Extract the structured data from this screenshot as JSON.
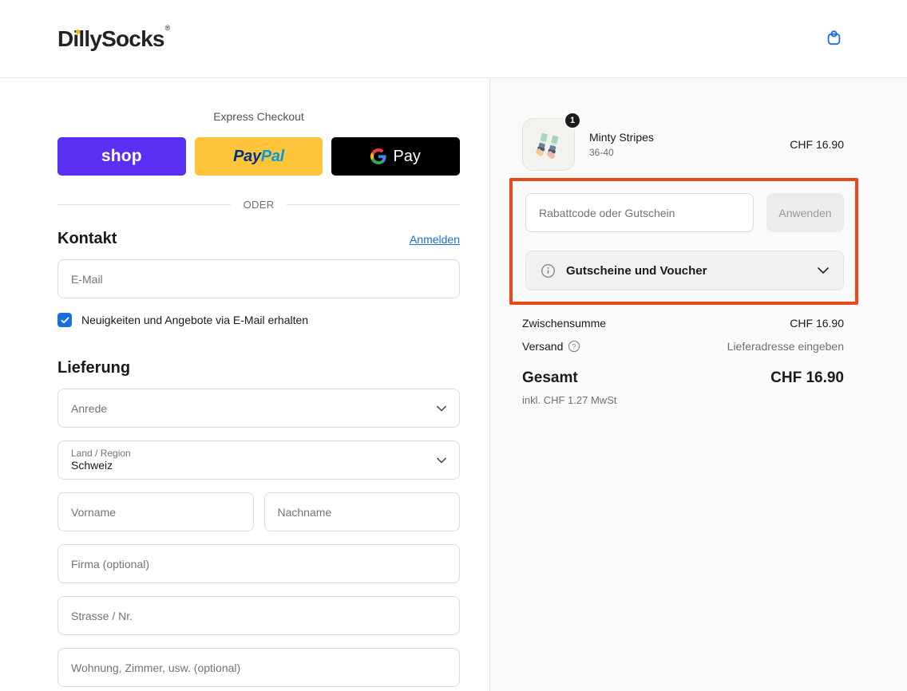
{
  "header": {
    "logo_text": "DillySocks",
    "logo_reg": "®"
  },
  "express": {
    "title": "Express Checkout",
    "divider": "ODER",
    "shop_label": "shop",
    "paypal_pay": "Pay",
    "paypal_pal": "Pal",
    "gpay_label": "Pay"
  },
  "contact": {
    "title": "Kontakt",
    "login_link": "Anmelden",
    "email_placeholder": "E-Mail",
    "newsletter_label": "Neuigkeiten und Angebote via E-Mail erhalten"
  },
  "shipping": {
    "title": "Lieferung",
    "anrede_placeholder": "Anrede",
    "country_label": "Land / Region",
    "country_value": "Schweiz",
    "vorname_placeholder": "Vorname",
    "nachname_placeholder": "Nachname",
    "firma_placeholder": "Firma (optional)",
    "strasse_placeholder": "Strasse / Nr.",
    "wohnung_placeholder": "Wohnung, Zimmer, usw. (optional)"
  },
  "cart": {
    "item": {
      "quantity": "1",
      "name": "Minty Stripes",
      "variant": "36-40",
      "price": "CHF 16.90"
    },
    "discount": {
      "placeholder": "Rabattcode oder Gutschein",
      "apply_label": "Anwenden",
      "voucher_label": "Gutscheine und Voucher"
    },
    "totals": {
      "subtotal_label": "Zwischensumme",
      "subtotal_value": "CHF 16.90",
      "shipping_label": "Versand",
      "shipping_value": "Lieferadresse eingeben",
      "total_label": "Gesamt",
      "total_value": "CHF 16.90",
      "tax_note": "inkl. CHF 1.27 MwSt"
    }
  },
  "icons": {
    "help": "?"
  },
  "colors": {
    "highlight_orange": "#e8491a",
    "link_blue": "#1a6fdb",
    "checkbox_blue": "#1a6fdb",
    "shop_purple": "#5a31f4",
    "paypal_yellow": "#ffc439",
    "paypal_dark_blue": "#003087",
    "paypal_light_blue": "#009cde",
    "gpay_black": "#000000",
    "logo_dot_yellow": "#f5b50a",
    "panel_gray": "#fafafa"
  }
}
